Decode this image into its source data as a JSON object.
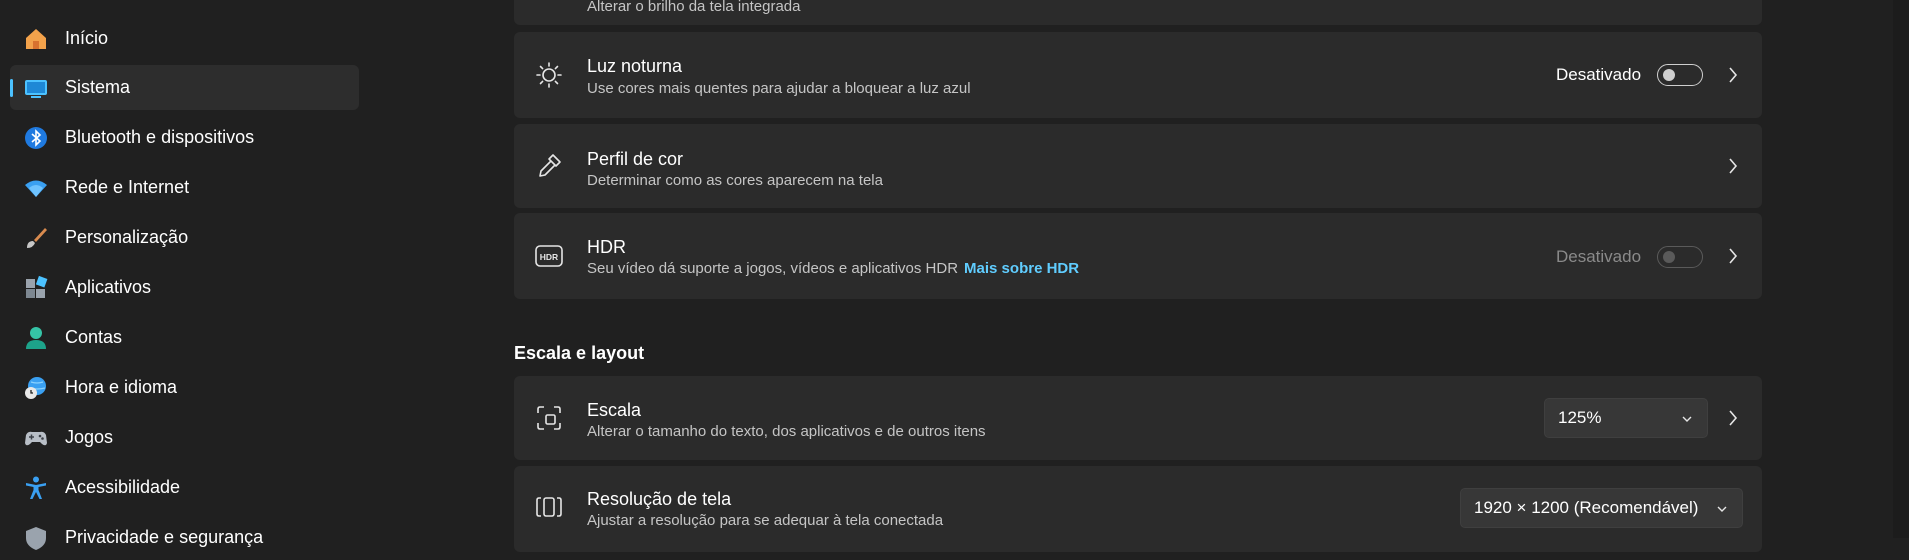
{
  "sidebar": {
    "items": [
      {
        "label": "Início",
        "icon": "home-icon"
      },
      {
        "label": "Sistema",
        "icon": "system-icon",
        "selected": true
      },
      {
        "label": "Bluetooth e dispositivos",
        "icon": "bluetooth-icon"
      },
      {
        "label": "Rede e Internet",
        "icon": "wifi-icon"
      },
      {
        "label": "Personalização",
        "icon": "brush-icon"
      },
      {
        "label": "Aplicativos",
        "icon": "apps-icon"
      },
      {
        "label": "Contas",
        "icon": "account-icon"
      },
      {
        "label": "Hora e idioma",
        "icon": "globe-clock-icon"
      },
      {
        "label": "Jogos",
        "icon": "gamepad-icon"
      },
      {
        "label": "Acessibilidade",
        "icon": "accessibility-icon"
      },
      {
        "label": "Privacidade e segurança",
        "icon": "shield-icon"
      }
    ]
  },
  "cards": {
    "brightness": {
      "subtitle": "Alterar o brilho da tela integrada"
    },
    "night_light": {
      "title": "Luz noturna",
      "subtitle": "Use cores mais quentes para ajudar a bloquear a luz azul",
      "status": "Desativado",
      "toggle_on": false
    },
    "color_profile": {
      "title": "Perfil de cor",
      "subtitle": "Determinar como as cores aparecem na tela"
    },
    "hdr": {
      "title": "HDR",
      "subtitle": "Seu vídeo dá suporte a jogos, vídeos e aplicativos HDR",
      "link": "Mais sobre HDR",
      "status": "Desativado",
      "toggle_on": false,
      "toggle_disabled": true
    },
    "scale": {
      "title": "Escala",
      "subtitle": "Alterar o tamanho do texto, dos aplicativos e de outros itens",
      "value": "125%"
    },
    "resolution": {
      "title": "Resolução de tela",
      "subtitle": "Ajustar a resolução para se adequar à tela conectada",
      "value": "1920 × 1200 (Recomendável)"
    }
  },
  "sections": {
    "scale_layout": "Escala e layout"
  },
  "colors": {
    "accent": "#4cc2ff",
    "link": "#60cdff",
    "card": "#2b2b2b",
    "background": "#202020"
  }
}
